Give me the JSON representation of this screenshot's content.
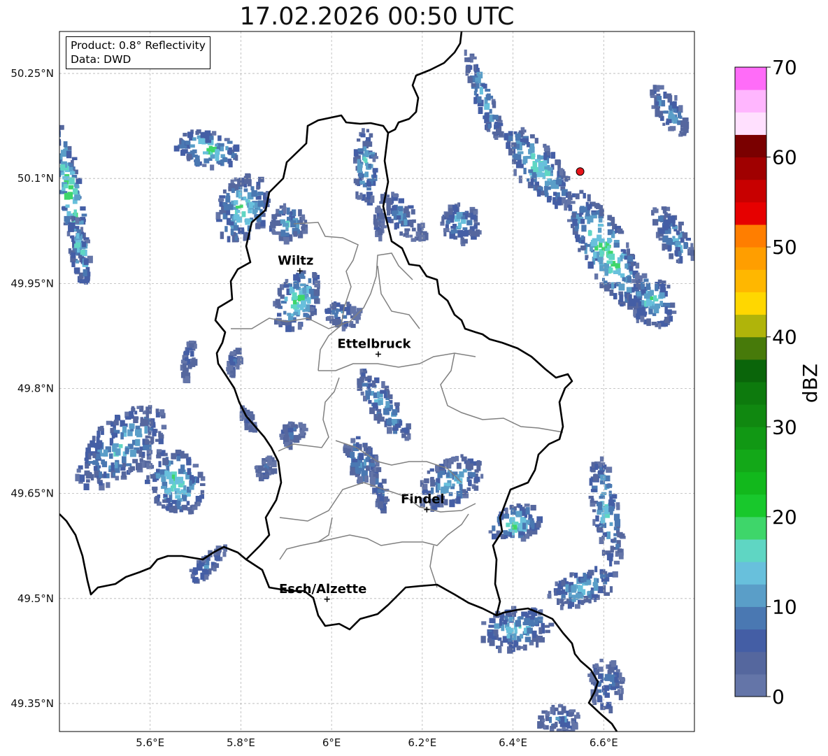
{
  "title": "17.02.2026 00:50 UTC",
  "info": {
    "product": "Product: 0.8° Reflectivity",
    "data": "Data: DWD"
  },
  "map": {
    "lon_range": [
      5.4,
      6.8
    ],
    "lat_range": [
      49.31,
      50.31
    ],
    "lon_ticks": [
      {
        "value": 5.6,
        "label": "5.6°E"
      },
      {
        "value": 5.8,
        "label": "5.8°E"
      },
      {
        "value": 6.0,
        "label": "6°E"
      },
      {
        "value": 6.2,
        "label": "6.2°E"
      },
      {
        "value": 6.4,
        "label": "6.4°E"
      },
      {
        "value": 6.6,
        "label": "6.6°E"
      }
    ],
    "lat_ticks": [
      {
        "value": 50.25,
        "label": "50.25°N"
      },
      {
        "value": 50.1,
        "label": "50.1°N"
      },
      {
        "value": 49.95,
        "label": "49.95°N"
      },
      {
        "value": 49.8,
        "label": "49.8°N"
      },
      {
        "value": 49.65,
        "label": "49.65°N"
      },
      {
        "value": 49.5,
        "label": "49.5°N"
      },
      {
        "value": 49.35,
        "label": "49.35°N"
      }
    ],
    "cities": [
      {
        "name": "Wiltz",
        "lon": 5.93,
        "lat": 49.968
      },
      {
        "name": "Ettelbruck",
        "lon": 6.103,
        "lat": 49.849
      },
      {
        "name": "Findel",
        "lon": 6.21,
        "lat": 49.627
      },
      {
        "name": "Esch/Alzette",
        "lon": 5.99,
        "lat": 49.499
      }
    ],
    "radar_site": {
      "lon": 6.548,
      "lat": 50.11,
      "color": "#e8141a"
    }
  },
  "colorbar": {
    "label": "dBZ",
    "min": 0,
    "max": 70,
    "step": 2.5,
    "ticks": [
      0,
      10,
      20,
      30,
      40,
      50,
      60,
      70
    ],
    "colors": [
      "#6475a8",
      "#55679e",
      "#445ea5",
      "#4a78b2",
      "#5a9ec8",
      "#68c0dc",
      "#5fd6c3",
      "#3ed66a",
      "#18c82c",
      "#12b81c",
      "#13a818",
      "#119814",
      "#108810",
      "#0d7a0d",
      "#0a650a",
      "#477a0a",
      "#b0b40a",
      "#ffd700",
      "#ffb700",
      "#ff9e00",
      "#ff7e00",
      "#e60000",
      "#c80000",
      "#a00000",
      "#7a0000",
      "#ffe0fe",
      "#ffb6fe",
      "#ff6cf8",
      "#e838ec"
    ]
  },
  "echoes": [
    {
      "lon": 5.42,
      "lat": 50.08,
      "rlon": 0.025,
      "rlat": 0.1,
      "angle": -10,
      "intensity": 22
    },
    {
      "lon": 5.44,
      "lat": 50.0,
      "rlon": 0.02,
      "rlat": 0.05,
      "angle": -10,
      "intensity": 18
    },
    {
      "lon": 5.72,
      "lat": 50.145,
      "rlon": 0.07,
      "rlat": 0.025,
      "angle": 10,
      "intensity": 20
    },
    {
      "lon": 5.8,
      "lat": 50.06,
      "rlon": 0.055,
      "rlat": 0.05,
      "angle": 20,
      "intensity": 18
    },
    {
      "lon": 5.9,
      "lat": 50.04,
      "rlon": 0.04,
      "rlat": 0.025,
      "angle": 10,
      "intensity": 14
    },
    {
      "lon": 5.92,
      "lat": 49.93,
      "rlon": 0.045,
      "rlat": 0.045,
      "angle": 30,
      "intensity": 19
    },
    {
      "lon": 6.02,
      "lat": 49.91,
      "rlon": 0.04,
      "rlat": 0.02,
      "angle": 20,
      "intensity": 12
    },
    {
      "lon": 5.68,
      "lat": 49.845,
      "rlon": 0.012,
      "rlat": 0.03,
      "angle": 10,
      "intensity": 8
    },
    {
      "lon": 5.78,
      "lat": 49.84,
      "rlon": 0.012,
      "rlat": 0.02,
      "angle": 10,
      "intensity": 8
    },
    {
      "lon": 5.53,
      "lat": 49.72,
      "rlon": 0.12,
      "rlat": 0.04,
      "angle": -40,
      "intensity": 15
    },
    {
      "lon": 5.65,
      "lat": 49.67,
      "rlon": 0.06,
      "rlat": 0.05,
      "angle": -40,
      "intensity": 18
    },
    {
      "lon": 5.72,
      "lat": 49.55,
      "rlon": 0.06,
      "rlat": 0.012,
      "angle": -45,
      "intensity": 9
    },
    {
      "lon": 5.85,
      "lat": 49.69,
      "rlon": 0.025,
      "rlat": 0.012,
      "angle": -50,
      "intensity": 7
    },
    {
      "lon": 5.91,
      "lat": 49.74,
      "rlon": 0.03,
      "rlat": 0.015,
      "angle": -50,
      "intensity": 10
    },
    {
      "lon": 5.81,
      "lat": 49.76,
      "rlon": 0.012,
      "rlat": 0.018,
      "angle": -30,
      "intensity": 7
    },
    {
      "lon": 6.07,
      "lat": 50.12,
      "rlon": 0.025,
      "rlat": 0.055,
      "angle": 0,
      "intensity": 16
    },
    {
      "lon": 6.11,
      "lat": 49.78,
      "rlon": 0.03,
      "rlat": 0.06,
      "angle": -35,
      "intensity": 14
    },
    {
      "lon": 6.06,
      "lat": 49.7,
      "rlon": 0.035,
      "rlat": 0.035,
      "angle": -20,
      "intensity": 12
    },
    {
      "lon": 6.1,
      "lat": 49.66,
      "rlon": 0.015,
      "rlat": 0.03,
      "angle": -10,
      "intensity": 9
    },
    {
      "lon": 6.15,
      "lat": 50.05,
      "rlon": 0.03,
      "rlat": 0.045,
      "angle": -40,
      "intensity": 10
    },
    {
      "lon": 6.28,
      "lat": 50.04,
      "rlon": 0.04,
      "rlat": 0.03,
      "angle": -40,
      "intensity": 14
    },
    {
      "lon": 6.33,
      "lat": 50.22,
      "rlon": 0.02,
      "rlat": 0.07,
      "angle": -20,
      "intensity": 16
    },
    {
      "lon": 6.45,
      "lat": 50.12,
      "rlon": 0.045,
      "rlat": 0.07,
      "angle": -40,
      "intensity": 18
    },
    {
      "lon": 6.6,
      "lat": 50.0,
      "rlon": 0.05,
      "rlat": 0.1,
      "angle": -30,
      "intensity": 20
    },
    {
      "lon": 6.75,
      "lat": 50.02,
      "rlon": 0.03,
      "rlat": 0.05,
      "angle": -30,
      "intensity": 14
    },
    {
      "lon": 6.7,
      "lat": 49.93,
      "rlon": 0.05,
      "rlat": 0.04,
      "angle": -30,
      "intensity": 16
    },
    {
      "lon": 6.74,
      "lat": 50.2,
      "rlon": 0.03,
      "rlat": 0.04,
      "angle": -30,
      "intensity": 13
    },
    {
      "lon": 6.26,
      "lat": 49.67,
      "rlon": 0.08,
      "rlat": 0.03,
      "angle": -30,
      "intensity": 14
    },
    {
      "lon": 6.4,
      "lat": 49.61,
      "rlon": 0.06,
      "rlat": 0.025,
      "angle": -20,
      "intensity": 18
    },
    {
      "lon": 6.6,
      "lat": 49.63,
      "rlon": 0.03,
      "rlat": 0.08,
      "angle": -10,
      "intensity": 16
    },
    {
      "lon": 6.55,
      "lat": 49.52,
      "rlon": 0.08,
      "rlat": 0.025,
      "angle": -20,
      "intensity": 15
    },
    {
      "lon": 6.4,
      "lat": 49.46,
      "rlon": 0.08,
      "rlat": 0.03,
      "angle": -10,
      "intensity": 15
    },
    {
      "lon": 6.6,
      "lat": 49.38,
      "rlon": 0.04,
      "rlat": 0.035,
      "angle": 0,
      "intensity": 10
    },
    {
      "lon": 6.5,
      "lat": 49.33,
      "rlon": 0.05,
      "rlat": 0.02,
      "angle": 0,
      "intensity": 9
    },
    {
      "lon": 6.1,
      "lat": 50.04,
      "rlon": 0.01,
      "rlat": 0.025,
      "angle": 0,
      "intensity": 8
    }
  ]
}
